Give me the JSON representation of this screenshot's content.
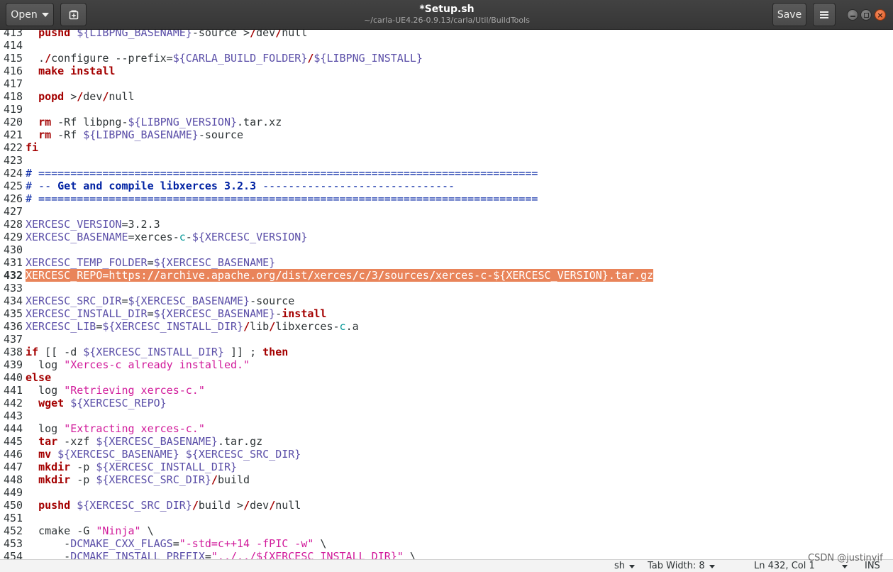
{
  "header": {
    "open_label": "Open",
    "title": "*Setup.sh",
    "subtitle": "~/carla-UE4.26-0.9.13/carla/Util/BuildTools",
    "save_label": "Save",
    "icons": {
      "new_tab": "new-document-icon",
      "menu": "hamburger-menu-icon",
      "minimize": "minimize-icon",
      "maximize": "maximize-icon",
      "close": "close-icon"
    }
  },
  "editor": {
    "current_line": "432",
    "lines": [
      {
        "n": "413",
        "t": "  pushd ${LIBPNG_BASENAME}-source >/dev/null"
      },
      {
        "n": "414",
        "t": ""
      },
      {
        "n": "415",
        "t": "  ./configure --prefix=${CARLA_BUILD_FOLDER}/${LIBPNG_INSTALL}"
      },
      {
        "n": "416",
        "t": "  make install"
      },
      {
        "n": "417",
        "t": ""
      },
      {
        "n": "418",
        "t": "  popd >/dev/null"
      },
      {
        "n": "419",
        "t": ""
      },
      {
        "n": "420",
        "t": "  rm -Rf libpng-${LIBPNG_VERSION}.tar.xz"
      },
      {
        "n": "421",
        "t": "  rm -Rf ${LIBPNG_BASENAME}-source"
      },
      {
        "n": "422",
        "t": "fi"
      },
      {
        "n": "423",
        "t": ""
      },
      {
        "n": "424",
        "t": "# =============================================================================="
      },
      {
        "n": "425",
        "t": "# -- Get and compile libxerces 3.2.3 ------------------------------"
      },
      {
        "n": "426",
        "t": "# =============================================================================="
      },
      {
        "n": "427",
        "t": ""
      },
      {
        "n": "428",
        "t": "XERCESC_VERSION=3.2.3"
      },
      {
        "n": "429",
        "t": "XERCESC_BASENAME=xerces-c-${XERCESC_VERSION}"
      },
      {
        "n": "430",
        "t": ""
      },
      {
        "n": "431",
        "t": "XERCESC_TEMP_FOLDER=${XERCESC_BASENAME}"
      },
      {
        "n": "432",
        "t": "XERCESC_REPO=https://archive.apache.org/dist/xerces/c/3/sources/xerces-c-${XERCESC_VERSION}.tar.gz"
      },
      {
        "n": "433",
        "t": ""
      },
      {
        "n": "434",
        "t": "XERCESC_SRC_DIR=${XERCESC_BASENAME}-source"
      },
      {
        "n": "435",
        "t": "XERCESC_INSTALL_DIR=${XERCESC_BASENAME}-install"
      },
      {
        "n": "436",
        "t": "XERCESC_LIB=${XERCESC_INSTALL_DIR}/lib/libxerces-c.a"
      },
      {
        "n": "437",
        "t": ""
      },
      {
        "n": "438",
        "t": "if [[ -d ${XERCESC_INSTALL_DIR} ]] ; then"
      },
      {
        "n": "439",
        "t": "  log \"Xerces-c already installed.\""
      },
      {
        "n": "440",
        "t": "else"
      },
      {
        "n": "441",
        "t": "  log \"Retrieving xerces-c.\""
      },
      {
        "n": "442",
        "t": "  wget ${XERCESC_REPO}"
      },
      {
        "n": "443",
        "t": ""
      },
      {
        "n": "444",
        "t": "  log \"Extracting xerces-c.\""
      },
      {
        "n": "445",
        "t": "  tar -xzf ${XERCESC_BASENAME}.tar.gz"
      },
      {
        "n": "446",
        "t": "  mv ${XERCESC_BASENAME} ${XERCESC_SRC_DIR}"
      },
      {
        "n": "447",
        "t": "  mkdir -p ${XERCESC_INSTALL_DIR}"
      },
      {
        "n": "448",
        "t": "  mkdir -p ${XERCESC_SRC_DIR}/build"
      },
      {
        "n": "449",
        "t": ""
      },
      {
        "n": "450",
        "t": "  pushd ${XERCESC_SRC_DIR}/build >/dev/null"
      },
      {
        "n": "451",
        "t": ""
      },
      {
        "n": "452",
        "t": "  cmake -G \"Ninja\" \\"
      },
      {
        "n": "453",
        "t": "      -DCMAKE_CXX_FLAGS=\"-std=c++14 -fPIC -w\" \\"
      },
      {
        "n": "454",
        "t": "      -DCMAKE_INSTALL_PREFIX=\"../../${XERCESC_INSTALL_DIR}\" \\"
      }
    ]
  },
  "statusbar": {
    "language": "sh",
    "tab_width": "Tab Width: 8",
    "position": "Ln 432, Col 1",
    "mode": "INS"
  },
  "watermark": "CSDN @justinyif",
  "colors": {
    "headerbar": "#3c3c3c",
    "highlight": "#e9845a",
    "keyword": "#a40000",
    "variable": "#5b4fa8",
    "string": "#d11b9b",
    "comment": "#0022a3"
  }
}
